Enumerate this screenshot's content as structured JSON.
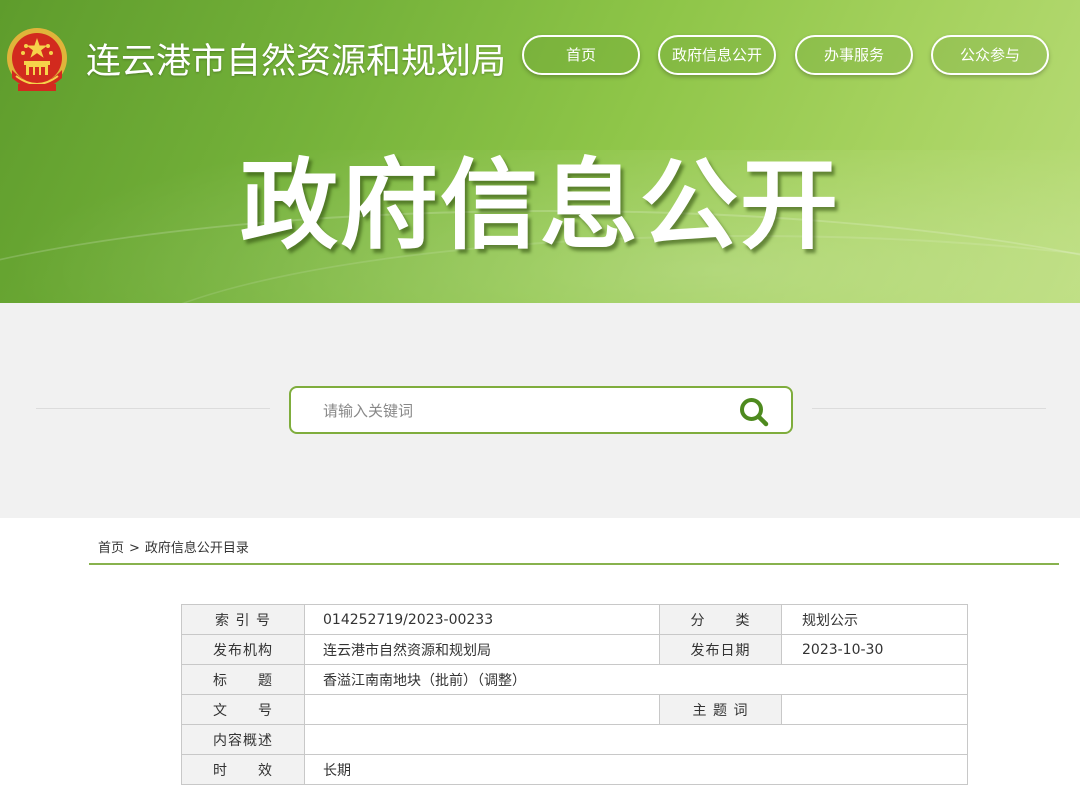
{
  "header": {
    "site_title": "连云港市自然资源和规划局",
    "nav": [
      {
        "label": "首页"
      },
      {
        "label": "政府信息公开"
      },
      {
        "label": "办事服务"
      },
      {
        "label": "公众参与"
      }
    ]
  },
  "hero": {
    "title": "政府信息公开"
  },
  "search": {
    "placeholder": "请输入关键词",
    "value": ""
  },
  "breadcrumb": {
    "home": "首页",
    "separator": ">",
    "current": "政府信息公开目录"
  },
  "info": {
    "index_label": "索 引 号",
    "index_value": "014252719/2023-00233",
    "category_label": "分　　类",
    "category_value": "规划公示",
    "publisher_label": "发布机构",
    "publisher_value": "连云港市自然资源和规划局",
    "date_label": "发布日期",
    "date_value": "2023-10-30",
    "title_label": "标　　题",
    "title_value": "香溢江南南地块（批前）（调整）",
    "doc_no_label": "文　　号",
    "doc_no_value": "",
    "subject_label": "主 题 词",
    "subject_value": "",
    "summary_label": "内容概述",
    "summary_value": "",
    "validity_label": "时　　效",
    "validity_value": "长期"
  },
  "colors": {
    "banner_green": "#75b23a",
    "accent_green": "#7fad3d",
    "search_icon_green": "#4e8a1f"
  }
}
